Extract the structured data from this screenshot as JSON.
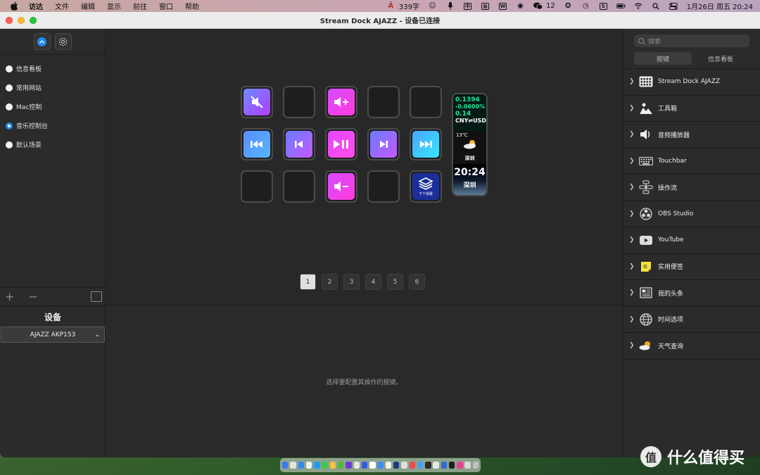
{
  "menubar": {
    "app": "访达",
    "items": [
      "文件",
      "编辑",
      "显示",
      "前往",
      "窗口",
      "帮助"
    ],
    "word_count": "339字",
    "battery_label": "12",
    "clock": "1月26日 周五 20:24"
  },
  "window": {
    "title": "Stream Dock AJAZZ - 设备已连接"
  },
  "left": {
    "profiles": [
      {
        "label": "信息看板",
        "selected": false
      },
      {
        "label": "常用网站",
        "selected": false
      },
      {
        "label": "Mac控制",
        "selected": false
      },
      {
        "label": "音乐控制台",
        "selected": true
      },
      {
        "label": "默认场景",
        "selected": false
      }
    ],
    "add_label": "+",
    "remove_label": "−",
    "device_title": "设备",
    "device_value": "AJAZZ AKP153"
  },
  "canvas": {
    "keys": [
      {
        "row": 0,
        "col": 0,
        "icon": "mute-icon",
        "style": "g-purple"
      },
      {
        "row": 0,
        "col": 1,
        "icon": "",
        "style": "empty"
      },
      {
        "row": 0,
        "col": 2,
        "icon": "volume-up-icon",
        "style": "g-magenta"
      },
      {
        "row": 0,
        "col": 3,
        "icon": "",
        "style": "empty"
      },
      {
        "row": 0,
        "col": 4,
        "icon": "",
        "style": "empty"
      },
      {
        "row": 1,
        "col": 0,
        "icon": "rewind-icon",
        "style": "g-blue"
      },
      {
        "row": 1,
        "col": 1,
        "icon": "previous-track-icon",
        "style": "g-violet"
      },
      {
        "row": 1,
        "col": 2,
        "icon": "play-pause-icon",
        "style": "g-pink"
      },
      {
        "row": 1,
        "col": 3,
        "icon": "next-track-icon",
        "style": "g-violet"
      },
      {
        "row": 1,
        "col": 4,
        "icon": "fast-forward-icon",
        "style": "g-cyan"
      },
      {
        "row": 2,
        "col": 0,
        "icon": "",
        "style": "empty"
      },
      {
        "row": 2,
        "col": 1,
        "icon": "",
        "style": "empty"
      },
      {
        "row": 2,
        "col": 2,
        "icon": "volume-down-icon",
        "style": "g-magenta"
      },
      {
        "row": 2,
        "col": 3,
        "icon": "",
        "style": "empty"
      },
      {
        "row": 2,
        "col": 4,
        "icon": "layers-icon",
        "style": "g-navy"
      }
    ],
    "next_scene_label": "下个场景",
    "widget": {
      "rate1": "0.1394",
      "rate2": "-0.0600%",
      "rate3": "0.14",
      "pair": "CNY⇌USD",
      "temp": "13℃",
      "weather_city": "深圳",
      "time": "20:24",
      "time_city": "深圳"
    },
    "pages": [
      "1",
      "2",
      "3",
      "4",
      "5",
      "6"
    ],
    "active_page": "1",
    "hint": "选择要配置其操作的按键。"
  },
  "right": {
    "search_placeholder": "搜索",
    "tabs": [
      "按键",
      "信息看板"
    ],
    "categories": [
      {
        "label": "Stream Dock AJAZZ",
        "icon": "keypad-icon"
      },
      {
        "label": "工具箱",
        "icon": "toolbox-icon"
      },
      {
        "label": "音频播放器",
        "icon": "speaker-icon"
      },
      {
        "label": "Touchbar",
        "icon": "keyboard-icon"
      },
      {
        "label": "操作流",
        "icon": "flow-icon"
      },
      {
        "label": "OBS Studio",
        "icon": "obs-icon"
      },
      {
        "label": "YouTube",
        "icon": "youtube-icon"
      },
      {
        "label": "实用便签",
        "icon": "sticky-note-icon"
      },
      {
        "label": "我的头条",
        "icon": "newspaper-icon"
      },
      {
        "label": "时间选项",
        "icon": "globe-icon"
      },
      {
        "label": "天气查询",
        "icon": "weather-icon"
      }
    ]
  },
  "watermark": "什么值得买",
  "colors": {
    "accent": "#1e8cf0",
    "window_bg": "#2b2b2b"
  }
}
